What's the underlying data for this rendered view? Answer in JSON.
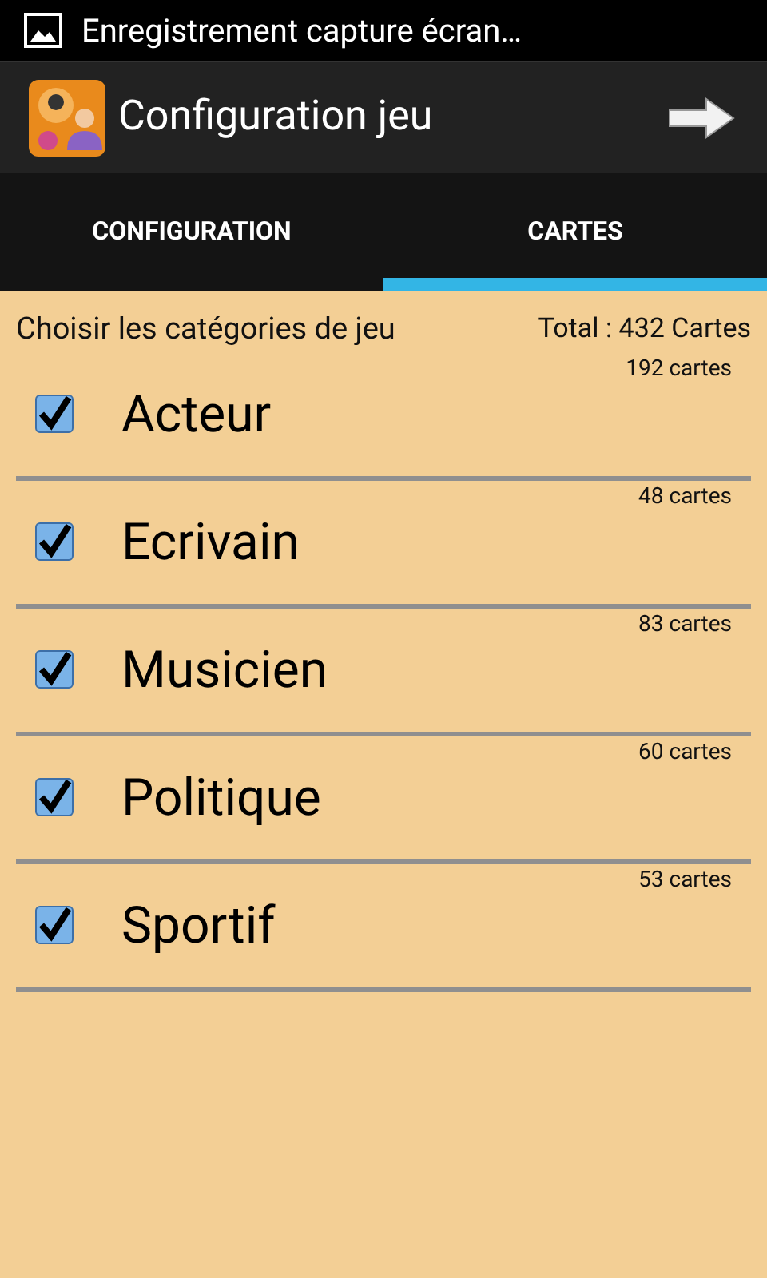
{
  "status_bar": {
    "notification": "Enregistrement capture écran…"
  },
  "action_bar": {
    "title": "Configuration jeu"
  },
  "tabs": [
    {
      "label": "CONFIGURATION",
      "selected": false
    },
    {
      "label": "CARTES",
      "selected": true
    }
  ],
  "header": {
    "prompt": "Choisir les catégories de jeu",
    "total": "Total : 432 Cartes"
  },
  "categories": [
    {
      "name": "Acteur",
      "count": "192 cartes",
      "checked": true
    },
    {
      "name": "Ecrivain",
      "count": "48 cartes",
      "checked": true
    },
    {
      "name": "Musicien",
      "count": "83 cartes",
      "checked": true
    },
    {
      "name": "Politique",
      "count": "60 cartes",
      "checked": true
    },
    {
      "name": "Sportif",
      "count": "53 cartes",
      "checked": true
    }
  ]
}
